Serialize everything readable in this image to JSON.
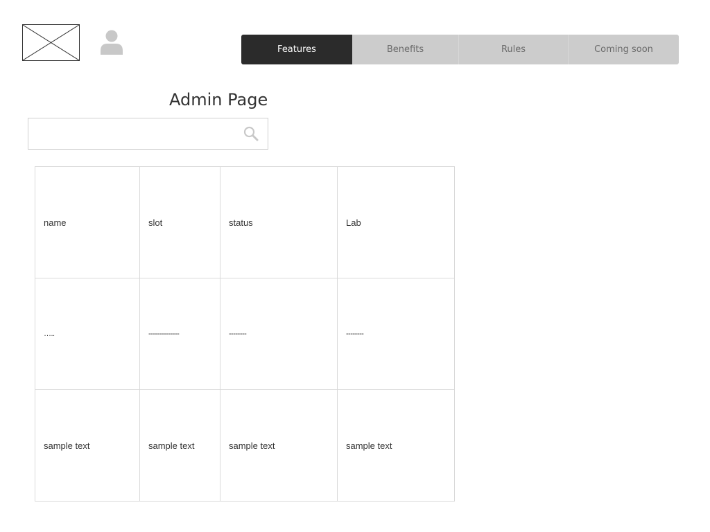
{
  "header": {
    "logo_icon": "image-placeholder-icon",
    "avatar_icon": "user-avatar-icon"
  },
  "nav": {
    "tabs": [
      {
        "label": "Features",
        "active": true
      },
      {
        "label": "Benefits",
        "active": false
      },
      {
        "label": "Rules",
        "active": false
      },
      {
        "label": "Coming soon",
        "active": false
      }
    ]
  },
  "main": {
    "title": "Admin Page",
    "search": {
      "value": "",
      "placeholder": "",
      "icon": "search-icon"
    }
  },
  "table": {
    "rows": [
      [
        "name",
        "slot",
        "status",
        "Lab"
      ],
      [
        "…..",
        "--------------",
        "--------",
        "--------"
      ],
      [
        "sample text",
        "sample text",
        "sample text",
        "sample text"
      ]
    ]
  },
  "colors": {
    "active_tab_bg": "#2b2b2b",
    "inactive_tab_bg": "#cccccc",
    "inactive_tab_text": "#6a6a6a",
    "border": "#d9d9d9",
    "icon_gray": "#c8c8c8"
  }
}
